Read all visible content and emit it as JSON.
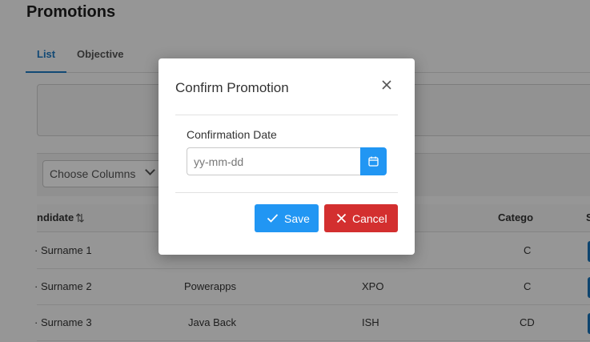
{
  "page": {
    "title": "Promotions",
    "tabs": [
      {
        "label": "List",
        "active": true
      },
      {
        "label": "Objective",
        "active": false
      }
    ],
    "toolbar": {
      "choose_columns": "Choose Columns"
    },
    "table": {
      "headers": [
        "ndidate",
        "Catego",
        "S"
      ],
      "rows": [
        {
          "candidate": "Surname 1",
          "project": "",
          "code": "",
          "category": "C"
        },
        {
          "candidate": "Surname 2",
          "project": "Powerapps",
          "code": "XPO",
          "category": "C"
        },
        {
          "candidate": "Surname 3",
          "project": "Java Back",
          "code": "ISH",
          "category": "CD"
        }
      ]
    }
  },
  "modal": {
    "title": "Confirm Promotion",
    "field_label": "Confirmation Date",
    "date_placeholder": "yy-mm-dd",
    "date_value": "",
    "save_label": "Save",
    "cancel_label": "Cancel",
    "icons": {
      "close": "close-icon",
      "calendar": "calendar-icon",
      "save": "check-icon",
      "cancel": "x-icon"
    }
  },
  "colors": {
    "accent": "#2196f3",
    "danger": "#d32f2f",
    "tab_active": "#1e7bc4",
    "status_chip": "#1872b8"
  }
}
